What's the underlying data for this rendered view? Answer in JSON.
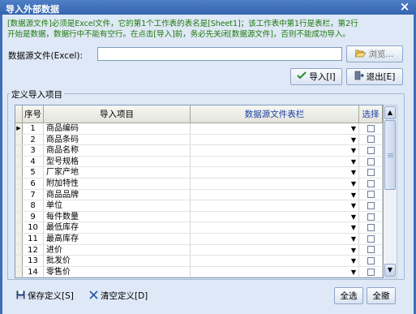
{
  "window": {
    "title": "导入外部数据",
    "close_icon": "×"
  },
  "notice": "[数据源文件]必须是Excel文件，它的第1个工作表的表名是[Sheet1]；该工作表中第1行是表栏，第2行\n开始是数据，数据行中不能有空行。在点击[导入]前，务必先关闭[数据源文件]，否则不能成功导入。",
  "source": {
    "label": "数据源文件(Excel):",
    "value": "",
    "browse_label": "浏览..."
  },
  "toolbar": {
    "import_label": "导入[I]",
    "exit_label": "退出[E]"
  },
  "section": {
    "title": "定义导入项目"
  },
  "grid": {
    "headers": {
      "no": "序号",
      "item": "导入项目",
      "source": "数据源文件表栏",
      "select": "选择"
    },
    "rows": [
      {
        "no": "1",
        "item": "商品编码"
      },
      {
        "no": "2",
        "item": "商品条码"
      },
      {
        "no": "3",
        "item": "商品名称"
      },
      {
        "no": "4",
        "item": "型号规格"
      },
      {
        "no": "5",
        "item": "厂家产地"
      },
      {
        "no": "6",
        "item": "附加特性"
      },
      {
        "no": "7",
        "item": "商品品牌"
      },
      {
        "no": "8",
        "item": "单位"
      },
      {
        "no": "9",
        "item": "每件数量"
      },
      {
        "no": "10",
        "item": "最低库存"
      },
      {
        "no": "11",
        "item": "最高库存"
      },
      {
        "no": "12",
        "item": "进价"
      },
      {
        "no": "13",
        "item": "批发价"
      },
      {
        "no": "14",
        "item": "零售价"
      }
    ]
  },
  "footer": {
    "save_label": "保存定义[S]",
    "clear_label": "清空定义[D]",
    "select_all_label": "全选",
    "cancel_all_label": "全撤"
  },
  "colors": {
    "accent": "#3e6fb8",
    "notice_text": "#1d7a0a",
    "header_blue": "#1a3fa6"
  },
  "icons": {
    "browse": "folder-open-icon",
    "import": "checkmark-icon",
    "exit": "exit-door-icon",
    "save": "floppy-disk-icon",
    "clear": "x-cross-icon",
    "row_pointer": "row-pointer-icon",
    "dropdown": "dropdown-arrow-icon"
  }
}
